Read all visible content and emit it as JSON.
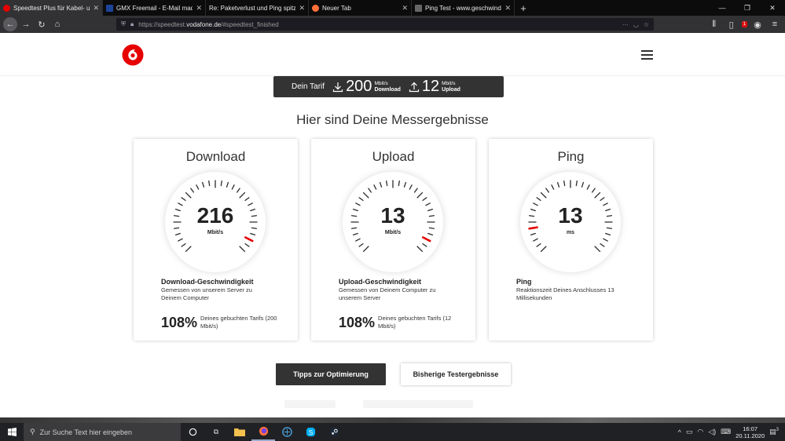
{
  "browser": {
    "tabs": [
      {
        "title": "Speedtest Plus für Kabel- und D",
        "favicon_color": "#e60000",
        "active": true
      },
      {
        "title": "GMX Freemail - E-Mail made in",
        "favicon_color": "#1c449b",
        "active": false
      },
      {
        "title": "Re: Paketverlust und Ping spitzen -",
        "favicon_color": "#333333",
        "active": false
      },
      {
        "title": "Neuer Tab",
        "favicon_color": "#ff7139",
        "active": false
      },
      {
        "title": "Ping Test - www.geschwindigkeit",
        "favicon_color": "#444444",
        "active": false
      }
    ],
    "url_prefix": "https://speedtest.",
    "url_domain": "vodafone.de",
    "url_path": "/#speedtest_finished",
    "adblock_badge": "1"
  },
  "brand": {
    "accent": "#e60000",
    "dark": "#333333"
  },
  "tarif": {
    "label": "Dein Tarif",
    "download_value": "200",
    "download_unit": "Mbit/s",
    "download_label": "Download",
    "upload_value": "12",
    "upload_unit": "Mbit/s",
    "upload_label": "Upload"
  },
  "heading": "Hier sind Deine Messergebnisse",
  "cards": {
    "download": {
      "title": "Download",
      "value": "216",
      "unit": "Mbit/s",
      "gauge_level": 0.93,
      "detail_title": "Download-Geschwindigkeit",
      "detail_desc": "Gemessen von unserem Server zu Deinem Computer",
      "percent": "108%",
      "percent_desc": "Deines gebuchten Tarifs (200 Mbit/s)"
    },
    "upload": {
      "title": "Upload",
      "value": "13",
      "unit": "Mbit/s",
      "gauge_level": 0.93,
      "detail_title": "Upload-Geschwindigkeit",
      "detail_desc": "Gemessen von Deinem Computer zu unserem Server",
      "percent": "108%",
      "percent_desc": "Deines gebuchten Tarifs (12 Mbit/s)"
    },
    "ping": {
      "title": "Ping",
      "value": "13",
      "unit": "ms",
      "gauge_level": 0.13,
      "detail_title": "Ping",
      "detail_desc": "Reaktionszeit Deines Anschlusses 13 Millisekunden"
    }
  },
  "buttons": {
    "tips": "Tipps zur Optimierung",
    "history": "Bisherige Testergebnisse"
  },
  "taskbar": {
    "search_placeholder": "Zur Suche Text hier eingeben",
    "time": "16:07",
    "date": "20.11.2020",
    "notification_count": "3"
  }
}
